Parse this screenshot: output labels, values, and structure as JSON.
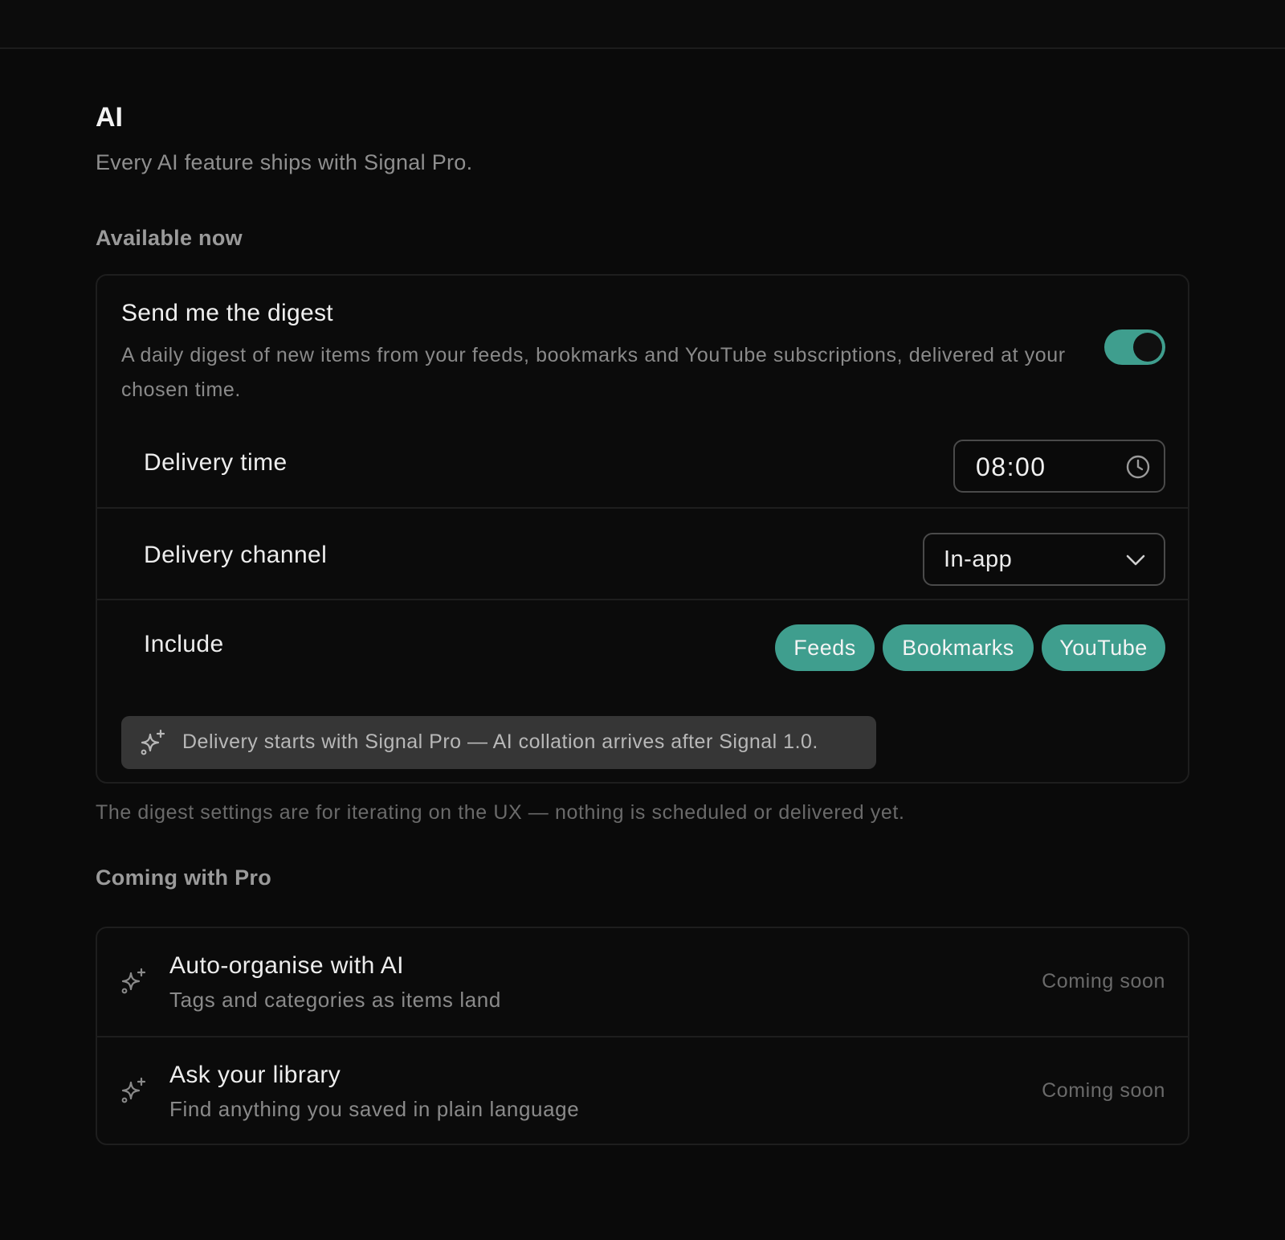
{
  "page": {
    "title": "AI",
    "subtitle": "Every AI feature ships with Signal Pro."
  },
  "available": {
    "heading": "Available now",
    "digest": {
      "title": "Send me the digest",
      "description": "A daily digest of new items from your feeds, bookmarks and YouTube subscriptions, delivered at your chosen time.",
      "enabled": true,
      "delivery_time": {
        "label": "Delivery time",
        "value": "08:00",
        "icon": "clock-icon"
      },
      "delivery_channel": {
        "label": "Delivery channel",
        "value": "In-app",
        "icon": "chevron-down-icon"
      },
      "include": {
        "label": "Include",
        "chips": [
          "Feeds",
          "Bookmarks",
          "YouTube"
        ]
      },
      "notice": {
        "icon": "sparkles-icon",
        "text": "Delivery starts with Signal Pro — AI collation arrives after Signal 1.0."
      }
    },
    "footnote": "The digest settings are for iterating on the UX — nothing is scheduled or delivered yet."
  },
  "coming": {
    "heading": "Coming with Pro",
    "items": [
      {
        "icon": "sparkles-icon",
        "title": "Auto-organise with AI",
        "description": "Tags and categories as items land",
        "status": "Coming soon"
      },
      {
        "icon": "sparkles-icon",
        "title": "Ask your library",
        "description": "Find anything you saved in plain language",
        "status": "Coming soon"
      }
    ]
  },
  "colors": {
    "background": "#0a0a0a",
    "accent": "#3f9e8e",
    "card_border": "#1e1e1e",
    "notice_bg": "#363636"
  }
}
